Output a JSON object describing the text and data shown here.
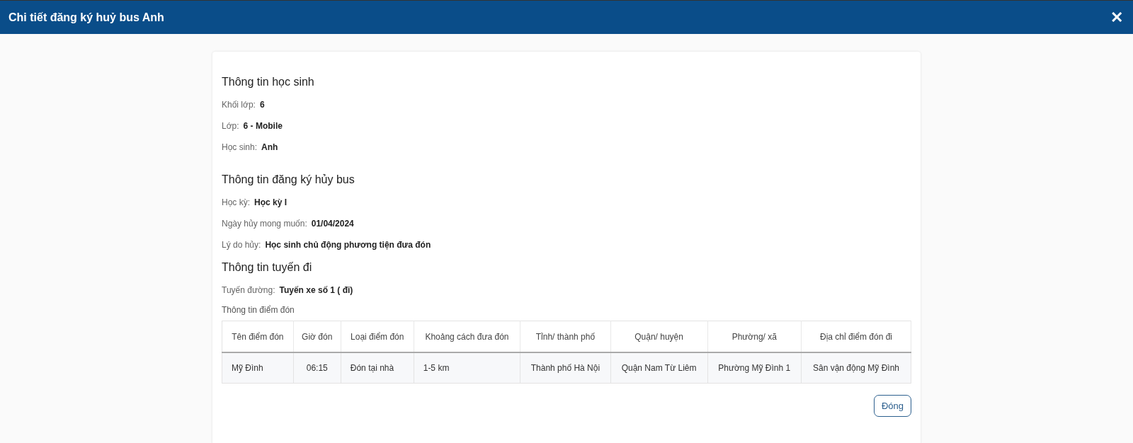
{
  "window": {
    "title": "Chi tiết đăng ký huỷ bus Anh",
    "close": "✕"
  },
  "sections": [
    {
      "title": "Thông tin học sinh",
      "fields": [
        {
          "label": "Khối lớp:",
          "value": "6"
        },
        {
          "label": "Lớp:",
          "value": "6 - Mobile"
        },
        {
          "label": "Học sinh:",
          "value": "Anh"
        }
      ]
    },
    {
      "title": "Thông tin đăng ký hủy bus",
      "fields": [
        {
          "label": "Học kỳ:",
          "value": "Học kỳ I"
        },
        {
          "label": "Ngày hủy mong muốn:",
          "value": "01/04/2024"
        },
        {
          "label": "Lý do hủy:",
          "value": "Học sinh chủ động phương tiện đưa đón"
        }
      ]
    },
    {
      "title": "Thông tin tuyến đi",
      "fields": [
        {
          "label": "Tuyến đường:",
          "value": "Tuyến xe số 1 ( đi)"
        }
      ]
    }
  ],
  "table": {
    "caption": "Thông tin điểm đón",
    "columns": [
      "Tên điểm đón",
      "Giờ đón",
      "Loại điểm đón",
      "Khoảng cách đưa đón",
      "Tỉnh/ thành phố",
      "Quận/ huyện",
      "Phường/ xã",
      "Địa chỉ điểm đón đi"
    ],
    "rows": [
      [
        "Mỹ Đình",
        "06:15",
        "Đón tại nhà",
        "1-5 km",
        "Thành phố Hà Nội",
        "Quận Nam Từ Liêm",
        "Phường Mỹ Đình 1",
        "Sân vận động Mỹ Đình"
      ]
    ]
  },
  "buttons": [
    "Đóng"
  ]
}
